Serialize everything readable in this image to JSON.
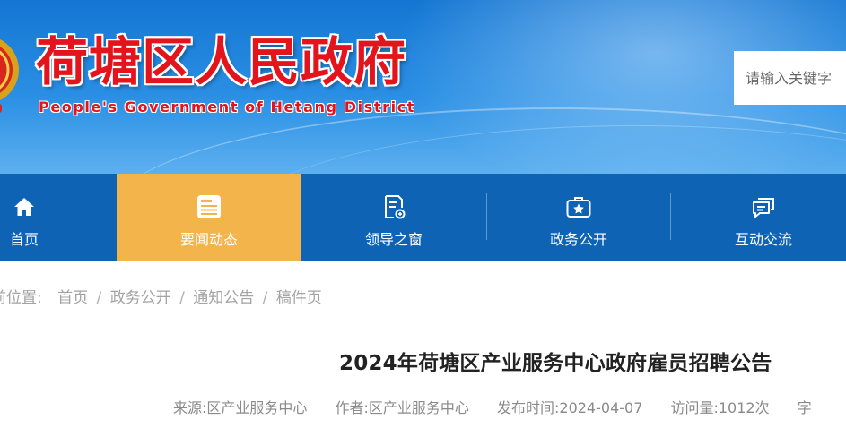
{
  "header": {
    "site_title": "荷塘区人民政府",
    "site_subtitle": "People's Government of Hetang District",
    "search": {
      "placeholder": "请输入关键字"
    }
  },
  "nav": {
    "items": [
      {
        "label": "首页",
        "icon": "home-icon",
        "active": false
      },
      {
        "label": "要闻动态",
        "icon": "newspaper-icon",
        "active": true
      },
      {
        "label": "领导之窗",
        "icon": "document-icon",
        "active": false
      },
      {
        "label": "政务公开",
        "icon": "briefcase-star-icon",
        "active": false
      },
      {
        "label": "互动交流",
        "icon": "chat-icon",
        "active": false
      }
    ],
    "colors": {
      "bar": "#0f63b5",
      "active": "#f3b44b"
    }
  },
  "breadcrumb": {
    "label": "前位置:",
    "items": [
      "首页",
      "政务公开",
      "通知公告",
      "稿件页"
    ]
  },
  "article": {
    "title": "2024年荷塘区产业服务中心政府雇员招聘公告",
    "meta": {
      "source": "来源:区产业服务中心",
      "author": "作者:区产业服务中心",
      "published": "发布时间:2024-04-07",
      "views": "访问量:1012次",
      "trailing": "字"
    }
  }
}
